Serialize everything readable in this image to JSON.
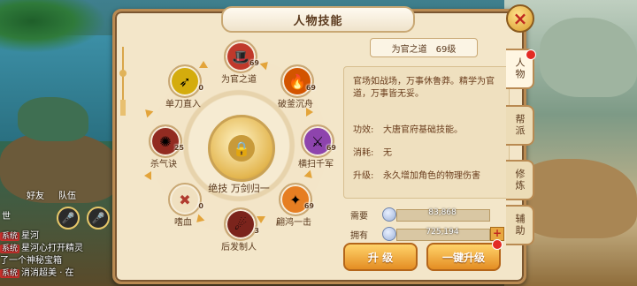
{
  "panel": {
    "title": "人物技能",
    "close_icon": "×"
  },
  "wheel": {
    "center_label": "绝技 万剑归一",
    "skills": [
      {
        "id": "weiguan",
        "name": "为官之道",
        "level": "69",
        "icon": "official-icon",
        "color": "#c0392b"
      },
      {
        "id": "pofu",
        "name": "破釜沉舟",
        "level": "69",
        "icon": "fire-icon",
        "color": "#d35400"
      },
      {
        "id": "hengsao",
        "name": "横扫千军",
        "level": "69",
        "icon": "sword-icon",
        "color": "#8e44ad"
      },
      {
        "id": "fanhong",
        "name": "翩鸿一击",
        "level": "69",
        "icon": "swoop-icon",
        "color": "#e67e22"
      },
      {
        "id": "houfa",
        "name": "后发制人",
        "level": "3",
        "icon": "counter-icon",
        "color": "#7b241c"
      },
      {
        "id": "shixue",
        "name": "嗜血",
        "level": "0",
        "icon": "blood-icon",
        "color": "#f0e0c0"
      },
      {
        "id": "shaqi",
        "name": "杀气诀",
        "level": "25",
        "icon": "aura-icon",
        "color": "#922b21"
      },
      {
        "id": "dandao",
        "name": "单刀直入",
        "level": "0",
        "icon": "blade-icon",
        "color": "#d4ac0d"
      }
    ]
  },
  "detail": {
    "skill_name": "为官之道",
    "skill_level": "69级",
    "description": "官场如战场，万事休鲁莽。精学为官道，万事皆无妥。",
    "effect_label": "功效:",
    "effect_value": "大唐官府基础技能。",
    "cost_label": "消耗:",
    "cost_value": "无",
    "upgrade_label": "升级:",
    "upgrade_value": "永久增加角色的物理伤害",
    "need_label": "需要",
    "need_value": "83,868",
    "have_label": "拥有",
    "have_value": "725,194",
    "plus_icon": "+",
    "upgrade_button": "升 级",
    "oneclick_button": "一键升级"
  },
  "tabs": [
    {
      "label": "人物",
      "active": true
    },
    {
      "label": "帮派",
      "active": false
    },
    {
      "label": "修炼",
      "active": false
    },
    {
      "label": "辅助",
      "active": false
    }
  ],
  "scene": {
    "chat": [
      {
        "tag": "系统",
        "text": "星河"
      },
      {
        "tag": "系统",
        "text": "星河心打开精灵"
      },
      {
        "tag": "",
        "text": "了一个神秘宝箱"
      },
      {
        "tag": "系统",
        "text": "消消超美 · 在"
      }
    ],
    "hud_friend": "好友",
    "hud_team": "队伍",
    "hud_world": "世"
  }
}
